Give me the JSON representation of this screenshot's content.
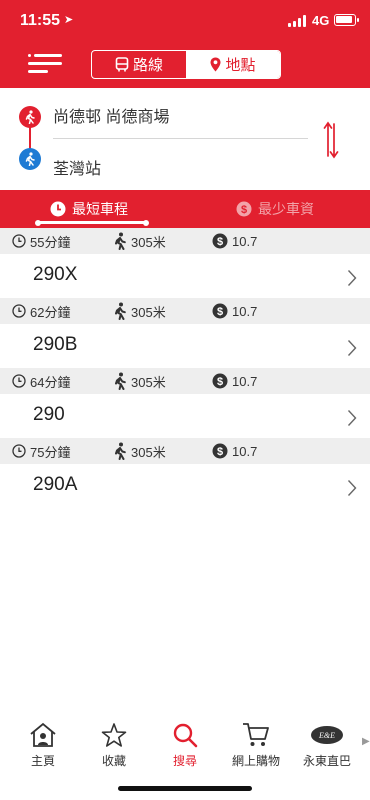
{
  "status_bar": {
    "time": "11:55",
    "network": "4G",
    "battery_level": 0.95
  },
  "header": {
    "tabs": [
      {
        "label": "路線",
        "icon": "bus-icon",
        "active": false
      },
      {
        "label": "地點",
        "icon": "location-pin-icon",
        "active": true
      }
    ]
  },
  "trip": {
    "origin": "尚德邨 尚德商場",
    "destination": "荃灣站"
  },
  "sort_tabs": [
    {
      "label": "最短車程",
      "icon": "clock-icon",
      "active": true
    },
    {
      "label": "最少車資",
      "icon": "dollar-icon",
      "active": false
    }
  ],
  "routes": [
    {
      "time": "55分鐘",
      "walk": "305米",
      "fare": "10.7",
      "name": "290X"
    },
    {
      "time": "62分鐘",
      "walk": "305米",
      "fare": "10.7",
      "name": "290B"
    },
    {
      "time": "64分鐘",
      "walk": "305米",
      "fare": "10.7",
      "name": "290"
    },
    {
      "time": "75分鐘",
      "walk": "305米",
      "fare": "10.7",
      "name": "290A"
    }
  ],
  "bottom_nav": [
    {
      "label": "主頁",
      "icon": "home-icon",
      "active": false
    },
    {
      "label": "收藏",
      "icon": "star-icon",
      "active": false
    },
    {
      "label": "搜尋",
      "icon": "search-icon",
      "active": true
    },
    {
      "label": "網上購物",
      "icon": "cart-icon",
      "active": false
    },
    {
      "label": "永東直巴",
      "icon": "ee-logo-icon",
      "active": false
    }
  ],
  "colors": {
    "brand_red": "#e2202f",
    "destination_blue": "#1e7bd4",
    "meta_bg": "#eeeeee"
  }
}
